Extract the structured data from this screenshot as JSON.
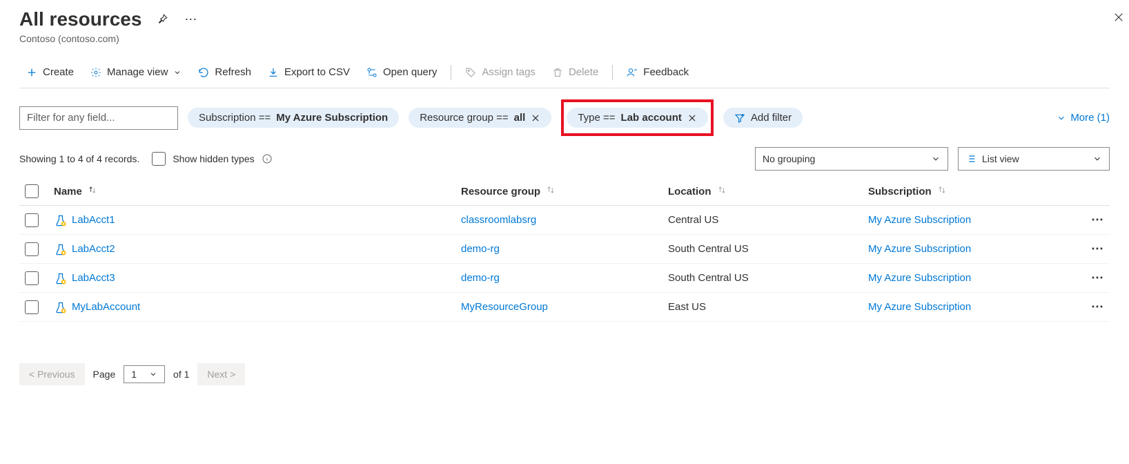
{
  "header": {
    "title": "All resources",
    "subtitle": "Contoso (contoso.com)"
  },
  "toolbar": {
    "create": "Create",
    "manage_view": "Manage view",
    "refresh": "Refresh",
    "export_csv": "Export to CSV",
    "open_query": "Open query",
    "assign_tags": "Assign tags",
    "delete": "Delete",
    "feedback": "Feedback"
  },
  "filters": {
    "placeholder": "Filter for any field...",
    "subscription_label": "Subscription == ",
    "subscription_value": "My Azure Subscription",
    "rg_label": "Resource group == ",
    "rg_value": "all",
    "type_label": "Type == ",
    "type_value": "Lab account",
    "add_filter": "Add filter",
    "more": "More (1)"
  },
  "status": {
    "showing": "Showing 1 to 4 of 4 records.",
    "show_hidden": "Show hidden types",
    "grouping": "No grouping",
    "view": "List view"
  },
  "columns": {
    "name": "Name",
    "rg": "Resource group",
    "loc": "Location",
    "sub": "Subscription"
  },
  "rows": [
    {
      "name": "LabAcct1",
      "rg": "classroomlabsrg",
      "loc": "Central US",
      "sub": "My Azure Subscription"
    },
    {
      "name": "LabAcct2",
      "rg": "demo-rg",
      "loc": "South Central US",
      "sub": "My Azure Subscription"
    },
    {
      "name": "LabAcct3",
      "rg": "demo-rg",
      "loc": "South Central US",
      "sub": "My Azure Subscription"
    },
    {
      "name": "MyLabAccount",
      "rg": "MyResourceGroup",
      "loc": "East US",
      "sub": "My Azure Subscription"
    }
  ],
  "pager": {
    "prev": "< Previous",
    "page_label": "Page",
    "page": "1",
    "of": "of 1",
    "next": "Next >"
  }
}
